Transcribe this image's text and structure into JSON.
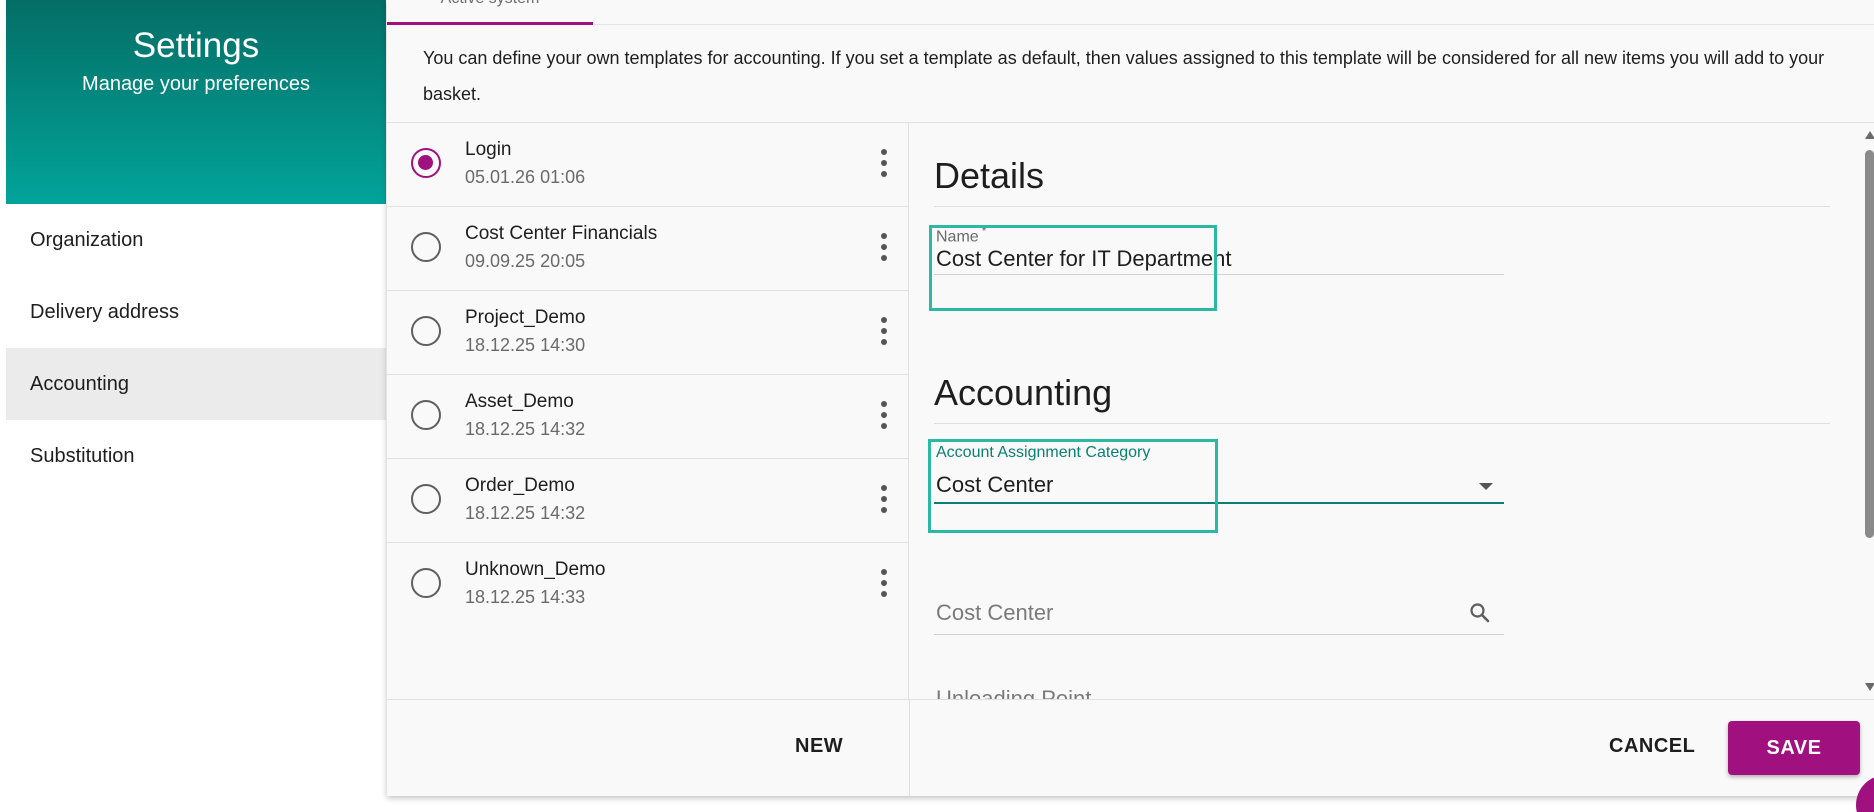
{
  "sidebar": {
    "title": "Settings",
    "subtitle": "Manage your preferences",
    "items": [
      {
        "label": "Organization"
      },
      {
        "label": "Delivery address"
      },
      {
        "label": "Accounting",
        "active": true
      },
      {
        "label": "Substitution"
      }
    ]
  },
  "tabs": {
    "active_label": "Active system"
  },
  "description": "You can define your own templates for accounting. If you set a template as default, then values assigned to this template will be considered for all new items you will add to your basket.",
  "templates": [
    {
      "name": "Login",
      "date": "05.01.26 01:06",
      "selected": true
    },
    {
      "name": "Cost Center Financials",
      "date": "09.09.25 20:05"
    },
    {
      "name": "Project_Demo",
      "date": "18.12.25 14:30"
    },
    {
      "name": "Asset_Demo",
      "date": "18.12.25 14:32"
    },
    {
      "name": "Order_Demo",
      "date": "18.12.25 14:32"
    },
    {
      "name": "Unknown_Demo",
      "date": "18.12.25 14:33"
    }
  ],
  "details": {
    "section_title": "Details",
    "name_label": "Name",
    "name_required_mark": "*",
    "name_value": "Cost Center for IT Department"
  },
  "accounting": {
    "section_title": "Accounting",
    "category_label": "Account Assignment Category",
    "category_value": "Cost Center",
    "cost_center_placeholder": "Cost Center",
    "unloading_point_placeholder": "Unloading Point"
  },
  "footer": {
    "new_label": "NEW",
    "cancel_label": "CANCEL",
    "save_label": "SAVE"
  },
  "colors": {
    "primary": "#a0107f",
    "header_teal_dark": "#046e66",
    "header_teal_light": "#02a49a",
    "highlight": "#2bb9a3"
  }
}
